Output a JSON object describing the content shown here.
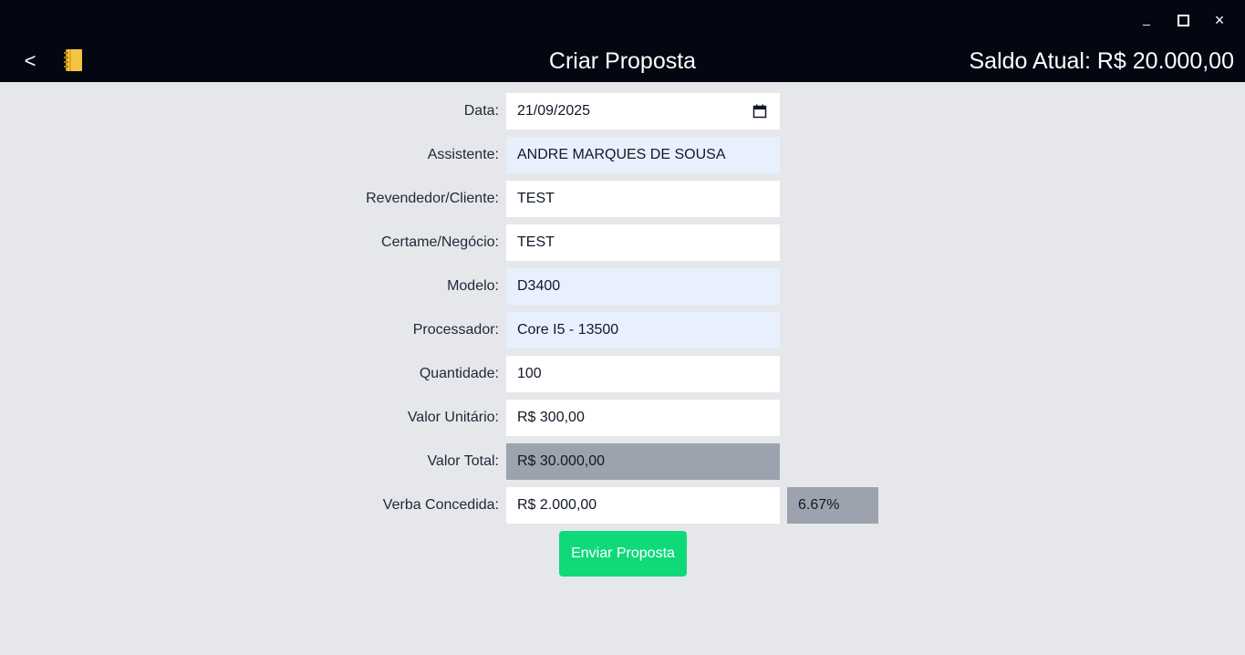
{
  "header": {
    "back_label": "<",
    "title": "Criar Proposta",
    "balance": "Saldo Atual: R$ 20.000,00",
    "logo_icon": "notebook-icon",
    "window_controls": {
      "minimize_label": "_",
      "maximize_icon": "maximize-icon",
      "close_label": "×"
    }
  },
  "form": {
    "data": {
      "label": "Data:",
      "value": "21/09/2025",
      "icon": "calendar-icon"
    },
    "assistente": {
      "label": "Assistente:",
      "value": "ANDRE MARQUES DE SOUSA"
    },
    "revendedor": {
      "label": "Revendedor/Cliente:",
      "value": "TEST"
    },
    "certame": {
      "label": "Certame/Negócio:",
      "value": "TEST"
    },
    "modelo": {
      "label": "Modelo:",
      "value": "D3400"
    },
    "processador": {
      "label": "Processador:",
      "value": "Core I5 - 13500"
    },
    "quantidade": {
      "label": "Quantidade:",
      "value": "100"
    },
    "valor_unitario": {
      "label": "Valor Unitário:",
      "value": "R$ 300,00"
    },
    "valor_total": {
      "label": "Valor Total:",
      "value": "R$ 30.000,00"
    },
    "verba": {
      "label": "Verba Concedida:",
      "value": "R$ 2.000,00",
      "percent": "6.67%"
    }
  },
  "submit_label": "Enviar Proposta",
  "colors": {
    "header_bg": "#030712",
    "page_bg": "#e5e7eb",
    "submit_bg": "#10d97a",
    "readonly_bg": "#9ca3af",
    "autofill_bg": "#e8f0fe"
  }
}
